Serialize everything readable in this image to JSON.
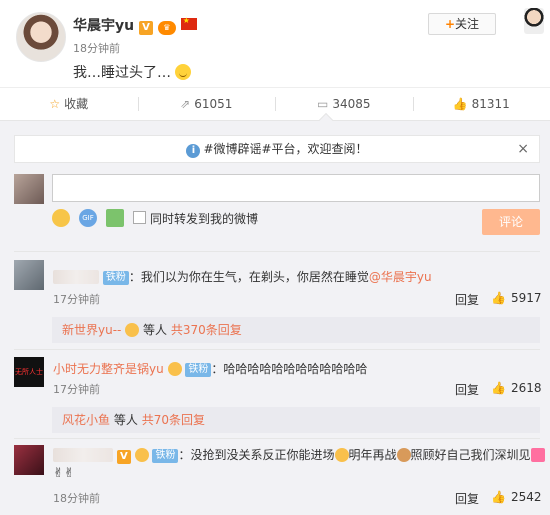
{
  "post": {
    "author": "华晨宇yu",
    "time": "18分钟前",
    "text": "我…睡过头了…",
    "follow_label": "+关注",
    "follow_plus": "+",
    "follow_text": "关注"
  },
  "actions": {
    "favorite": "收藏",
    "repost": "61051",
    "comment": "34085",
    "like": "81311"
  },
  "notice": {
    "text": "#微博辟谣#平台，欢迎查阅！",
    "close": "×"
  },
  "composer": {
    "input_value": "",
    "checkbox_label": "同时转发到我的微博",
    "submit": "评论",
    "gif_label": "GIF"
  },
  "comments": [
    {
      "user": "",
      "badge": "铁粉",
      "text": "：我们以为你在生气，在剃头，你居然在睡觉",
      "mention": "@华晨宇yu",
      "time": "17分钟前",
      "reply": "回复",
      "likes": "5917",
      "sub": {
        "user": "新世界yu--",
        "middle": "等人",
        "count": "共370条回复"
      }
    },
    {
      "user": "小时无力整齐是锅yu",
      "badge": "铁粉",
      "text": "：哈哈哈哈哈哈哈哈哈哈哈哈",
      "time": "17分钟前",
      "reply": "回复",
      "likes": "2618",
      "avatar_text": "无所人士",
      "sub": {
        "user": "风花小鱼",
        "middle": "等人",
        "count": "共70条回复"
      }
    },
    {
      "user": "",
      "badge": "铁粉",
      "text_a": "：没抢到没关系反正你能进场",
      "text_b": "明年再战",
      "text_c": "照顾好自己我们深圳见",
      "time": "18分钟前",
      "reply": "回复",
      "likes": "2542"
    }
  ],
  "colors": {
    "accent": "#eb7350",
    "comment_bg": "#f2f2f5",
    "badge_blue": "#79b7e8",
    "submit_disabled": "#ffb88f"
  }
}
